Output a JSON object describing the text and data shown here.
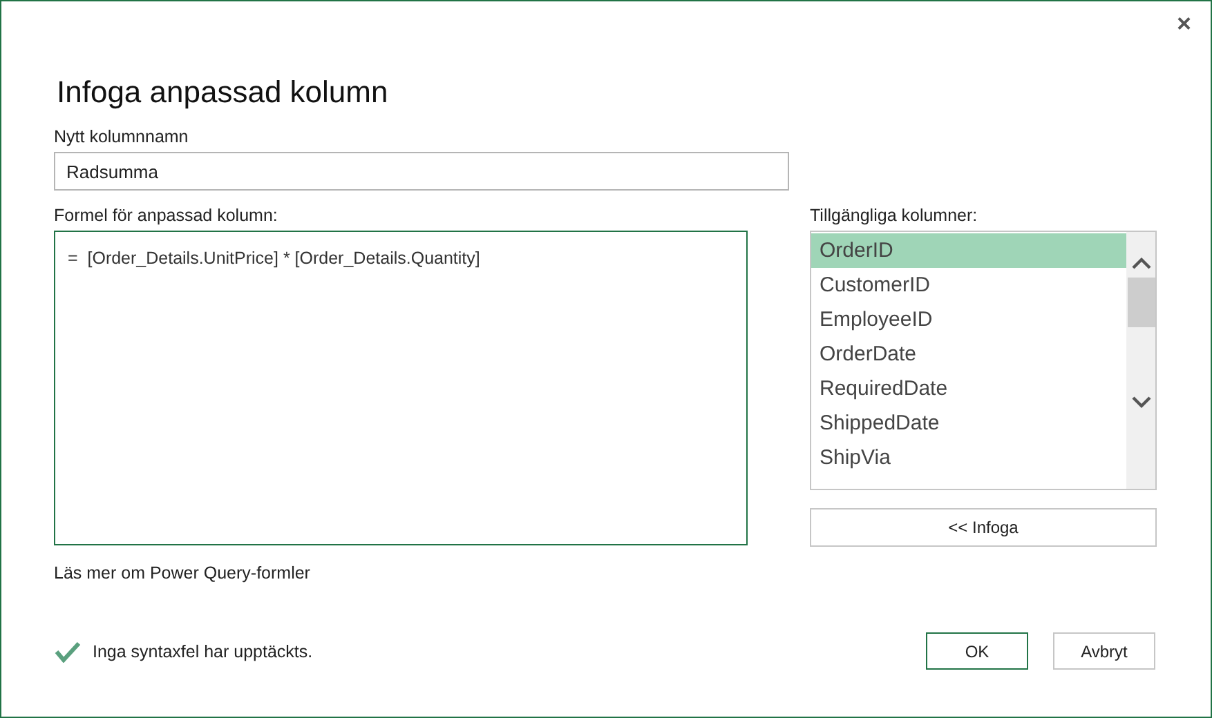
{
  "dialog": {
    "title": "Infoga anpassad kolumn",
    "close": "×"
  },
  "name_field": {
    "label": "Nytt kolumnnamn",
    "value": "Radsumma"
  },
  "formula": {
    "label": "Formel för anpassad kolumn:",
    "value": "=  [Order_Details.UnitPrice] * [Order_Details.Quantity]"
  },
  "columns": {
    "label": "Tillgängliga kolumner:",
    "items": [
      {
        "label": "OrderID",
        "selected": true
      },
      {
        "label": "CustomerID",
        "selected": false
      },
      {
        "label": "EmployeeID",
        "selected": false
      },
      {
        "label": "OrderDate",
        "selected": false
      },
      {
        "label": "RequiredDate",
        "selected": false
      },
      {
        "label": "ShippedDate",
        "selected": false
      },
      {
        "label": "ShipVia",
        "selected": false
      }
    ],
    "insert_button": "<< Infoga"
  },
  "help_link": "Läs mer om Power Query-formler",
  "status": {
    "ok": true,
    "text": "Inga syntaxfel har upptäckts."
  },
  "buttons": [
    {
      "label": "OK",
      "kind": "primary"
    },
    {
      "label": "Avbryt",
      "kind": "secondary"
    }
  ]
}
